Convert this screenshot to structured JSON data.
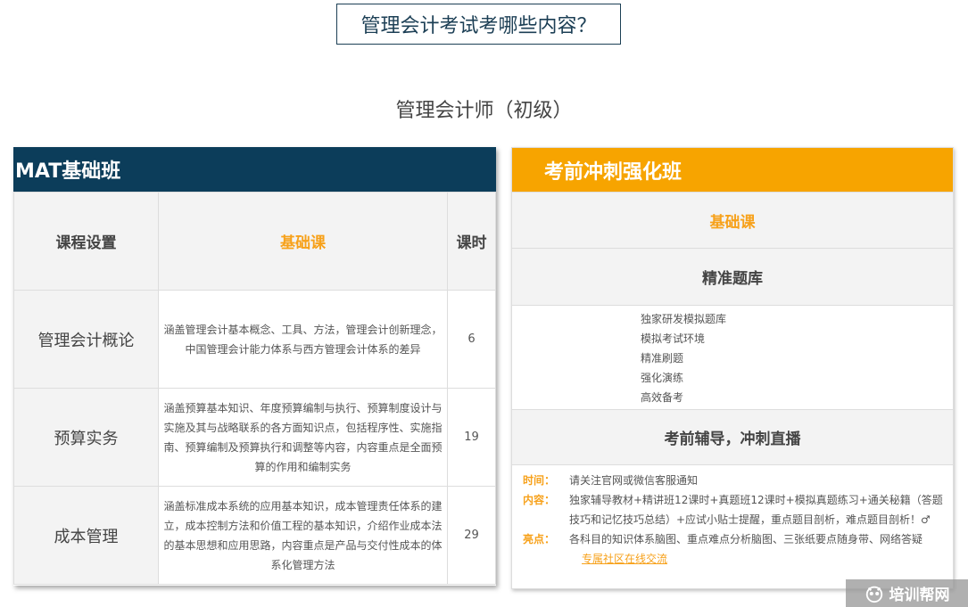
{
  "page": {
    "title": "管理会计考试考哪些内容？",
    "subtitle": "管理会计师（初级）"
  },
  "left": {
    "header": "MAT基础班",
    "col_headers": [
      "课程设置",
      "基础课",
      "课时"
    ],
    "rows": [
      {
        "name": "管理会计概论",
        "desc": "涵盖管理会计基本概念、工具、方法，管理会计创新理念，中国管理会计能力体系与西方管理会计体系的差异",
        "hours": "6"
      },
      {
        "name": "预算实务",
        "desc": "涵盖预算基本知识、年度预算编制与执行、预算制度设计与实施及其与战略联系的各方面知识点，包括程序性、实施指南、预算编制及预算执行和调整等内容，内容重点是全面预算的作用和编制实务",
        "hours": "19"
      },
      {
        "name": "成本管理",
        "desc": "涵盖标准成本系统的应用基本知识，成本管理责任体系的建立，成本控制方法和价值工程的基本知识，介绍作业成本法的基本思想和应用思路，内容重点是产品与交付性成本的体系化管理方法",
        "hours": "29"
      }
    ],
    "accent": "#0c3d5a"
  },
  "right": {
    "header": "考前冲刺强化班",
    "basic": "基础课",
    "bank": "精准题库",
    "features": [
      "独家研发模拟题库",
      "模拟考试环境",
      "精准刷题",
      "强化演练",
      "高效备考"
    ],
    "live": "考前辅导，冲刺直播",
    "details": {
      "time_label": "时间：",
      "time_text": "请关注官网或微信客服通知",
      "content_label": "内容：",
      "content_text": "独家辅导教材+精讲班12课时+真题班12课时+模拟真题练习+通关秘籍（答题技巧和记忆技巧总结）+应试小贴士提醒，重点题目剖析，难点题目剖析！♂",
      "highlight_label": "亮点：",
      "highlight_text": "各科目的知识体系脑图、重点难点分析脑图、三张纸要点随身带、网络答疑",
      "link_text": "专属社区在线交流"
    },
    "accent": "#f7a400"
  },
  "watermark": {
    "text": "培训帮网",
    "icon": "owl-logo-icon"
  }
}
